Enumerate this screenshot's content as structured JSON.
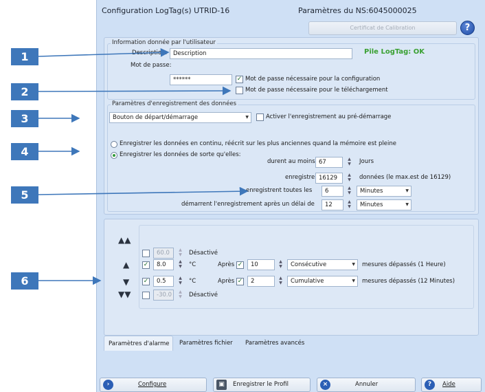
{
  "window": {
    "title": "Configuration LogTag(s) UTRID-16",
    "serial": "Paramètres du NS:6045000025",
    "cert_button": "Certificat de Calibration",
    "help": "?"
  },
  "callouts": [
    "1",
    "2",
    "3",
    "4",
    "5",
    "6"
  ],
  "user_info": {
    "legend": "Information donnée par l'utilisateur",
    "description_label": "Description:",
    "description_value": "Description",
    "status": "Pile LogTag: OK",
    "password_label": "Mot de passe:",
    "password_value": "******",
    "cb_config_label": "Mot de passe nécessaire pour la configuration",
    "cb_config_checked": true,
    "cb_download_label": "Mot de passe nécessaire pour le téléchargement",
    "cb_download_checked": false
  },
  "recording": {
    "legend": "Paramètres d'enregistrement des données",
    "start_mode": "Bouton de départ/démarrage",
    "prestart_label": "Activer l'enregistrement au pré-démarrage",
    "prestart_checked": false,
    "radio_continuous": "Enregistrer les données en continu, réécrit sur les plus anciennes quand la mémoire est pleine",
    "radio_until": "Enregistrer les données de sorte qu'elles:",
    "radio_selected": "until",
    "duration_label": "durent au moins",
    "duration_value": "67",
    "duration_unit": "Jours",
    "count_label": "enregistrent",
    "count_value": "16129",
    "count_note": "données (le max.est de 16129)",
    "interval_label": "enregistrent toutes les",
    "interval_value": "6",
    "interval_unit": "Minutes",
    "delay_label": "démarrent l'enregistrement après un délai de",
    "delay_value": "12",
    "delay_unit": "Minutes"
  },
  "alarms": [
    {
      "icon": "double-up-arrow-icon",
      "enabled": false,
      "value": "60.0",
      "unit": "",
      "text": "Désactivé"
    },
    {
      "icon": "up-arrow-icon",
      "enabled": true,
      "value": "8.0",
      "unit": "°C",
      "after_label": "Après",
      "after_checked": true,
      "count": "10",
      "mode": "Consécutive",
      "suffix": "mesures dépassés (1 Heure)"
    },
    {
      "icon": "down-arrow-icon",
      "enabled": true,
      "value": "0.5",
      "unit": "°C",
      "after_label": "Après",
      "after_checked": true,
      "count": "2",
      "mode": "Cumulative",
      "suffix": "mesures dépassés (12 Minutes)"
    },
    {
      "icon": "double-down-arrow-icon",
      "enabled": false,
      "value": "-30.0",
      "unit": "",
      "text": "Désactivé"
    }
  ],
  "tabs": [
    "Paramètres d'alarme",
    "Paramètres fichier",
    "Paramètres avancés"
  ],
  "footer": {
    "configure": "Configure",
    "save_profile": "Enregistrer le Profil",
    "cancel": "Annuler",
    "help": "Aide"
  }
}
